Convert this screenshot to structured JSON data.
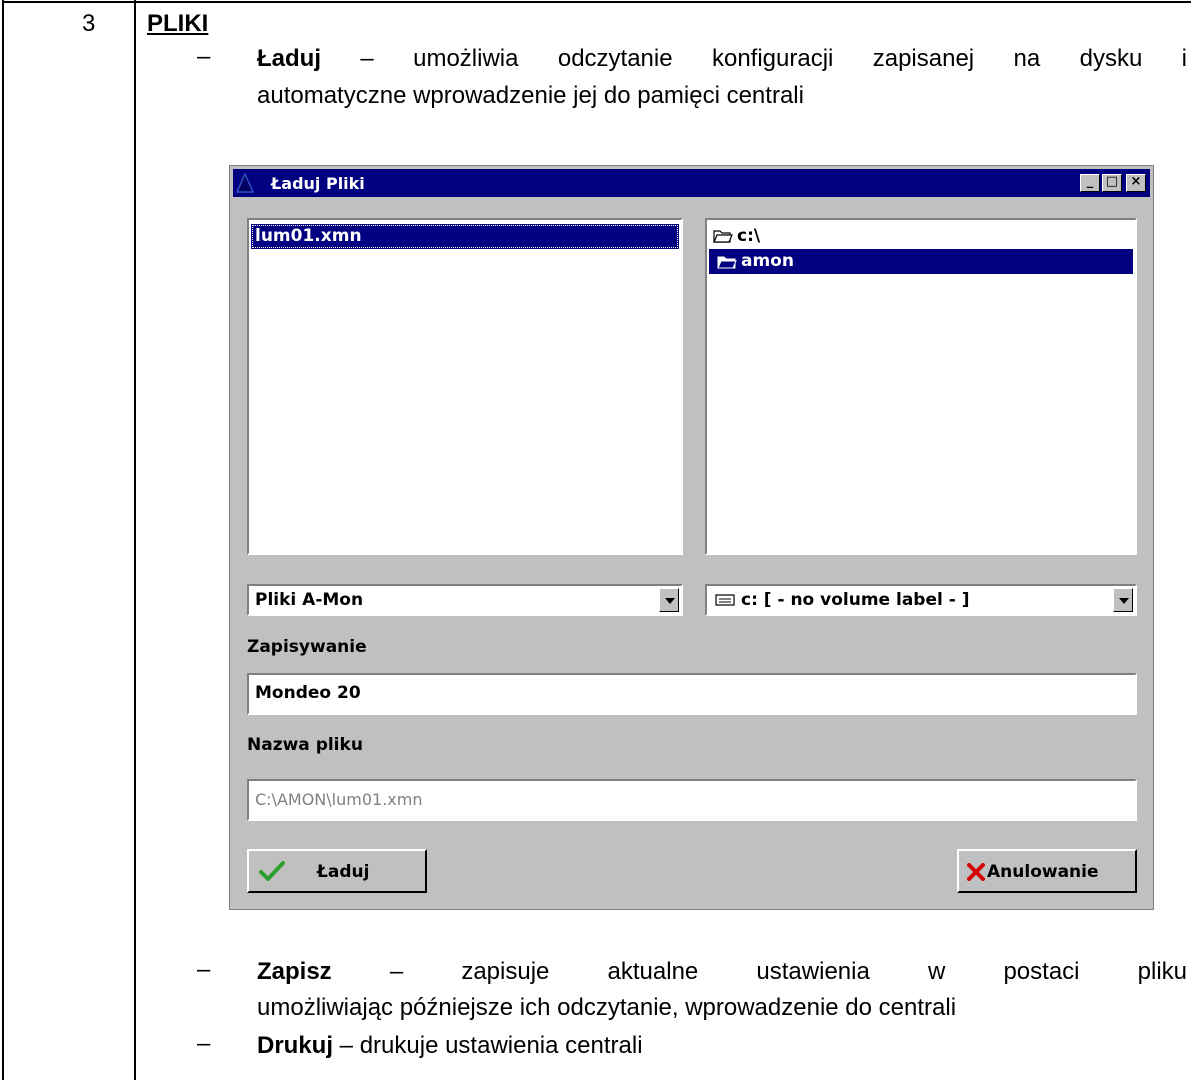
{
  "row": {
    "number": "3",
    "heading": "PLIKI"
  },
  "bullets": {
    "dash": "–",
    "laduj": {
      "term": "Ładuj",
      "line1_rest": " – umożliwia odczytanie konfiguracji zapisanej na dysku i",
      "line2": "automatyczne wprowadzenie jej do pamięci centrali"
    },
    "zapisz": {
      "term": "Zapisz",
      "line1_rest": " – zapisuje aktualne ustawienia w postaci pliku",
      "line2": "umożliwiając późniejsze ich odczytanie, wprowadzenie do centrali"
    },
    "drukuj": {
      "term": "Drukuj",
      "rest": " – drukuje ustawienia centrali"
    }
  },
  "dialog": {
    "title": "Ładuj Pliki",
    "titlebar_buttons": {
      "minimize": "_",
      "maximize": "□",
      "close": "×"
    },
    "files": [
      "lum01.xmn"
    ],
    "folders": [
      "c:\\",
      "amon"
    ],
    "file_type": "Pliki A-Mon",
    "drive": "c: [ - no volume label - ]",
    "description_label": "Zapisywanie",
    "description_value": "Mondeo 20",
    "filename_label": "Nazwa pliku",
    "filename_value": "C:\\AMON\\lum01.xmn",
    "load_button": "Ładuj",
    "cancel_button": "Anulowanie"
  },
  "colors": {
    "titlebar": "#000080",
    "selection": "#000080",
    "dialog_face": "#c0c0c0",
    "check": "#2e9e2e",
    "cancel_x": "#d00000"
  }
}
